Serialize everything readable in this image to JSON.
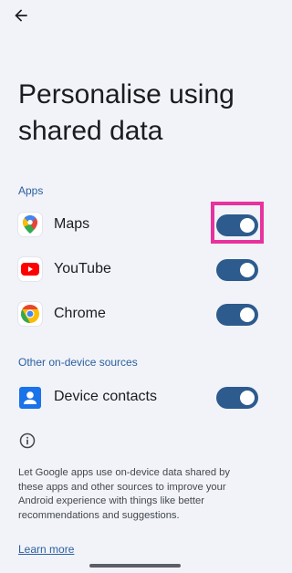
{
  "title": "Personalise using shared data",
  "sections": {
    "apps": "Apps",
    "other": "Other on-device sources"
  },
  "apps": [
    {
      "label": "Maps",
      "icon": "google-maps-icon",
      "enabled": true
    },
    {
      "label": "YouTube",
      "icon": "youtube-icon",
      "enabled": true
    },
    {
      "label": "Chrome",
      "icon": "chrome-icon",
      "enabled": true
    }
  ],
  "other": [
    {
      "label": "Device contacts",
      "icon": "contacts-icon",
      "enabled": true
    }
  ],
  "description": "Let Google apps use on-device data shared by these apps and other sources to improve your Android experience with things like better recommendations and suggestions.",
  "learn_more": "Learn more",
  "colors": {
    "background": "#f1f3f9",
    "accent": "#2d5b8d",
    "link": "#2b5f9e",
    "highlight": "#e8329d"
  }
}
